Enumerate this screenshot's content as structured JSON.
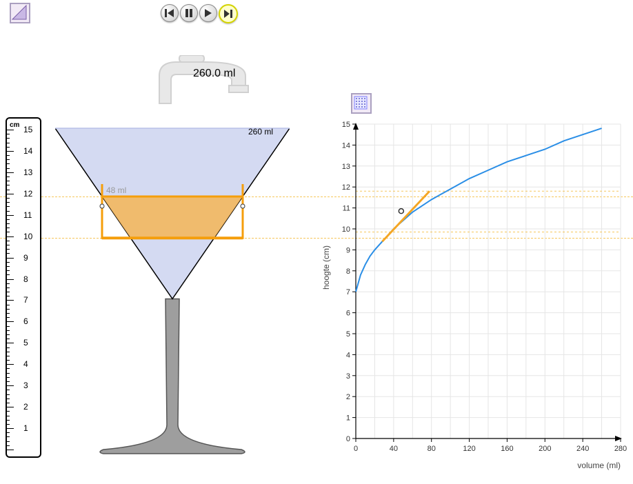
{
  "controls": {
    "restart": "⏮",
    "pause": "⏸",
    "play": "▶",
    "end": "⏭"
  },
  "tap": {
    "volume_label": "260.0 ml"
  },
  "ruler": {
    "unit": "cm",
    "max_tick": 15,
    "labels": [
      1,
      2,
      3,
      4,
      5,
      6,
      7,
      8,
      9,
      10,
      11,
      12,
      13,
      14,
      15
    ]
  },
  "glass": {
    "total_volume_label": "260 ml",
    "slice_volume_label": "48 ml"
  },
  "markers": {
    "lower_height_cm": 9.85,
    "upper_height_cm": 11.8,
    "point_height_cm": 10.85,
    "point_volume_ml": 48
  },
  "chart_data": {
    "type": "line",
    "title": "",
    "xlabel": "volume (ml)",
    "ylabel": "hoogte (cm)",
    "xlim": [
      0,
      280
    ],
    "ylim": [
      0,
      15
    ],
    "xticks": [
      0,
      40,
      80,
      120,
      160,
      200,
      240,
      280
    ],
    "yticks": [
      0,
      1,
      2,
      3,
      4,
      5,
      6,
      7,
      8,
      9,
      10,
      11,
      12,
      13,
      14,
      15
    ],
    "series": [
      {
        "name": "hoogte",
        "color": "#2a8ee6",
        "x": [
          0,
          5,
          10,
          15,
          20,
          30,
          40,
          50,
          60,
          80,
          100,
          120,
          140,
          160,
          180,
          200,
          220,
          240,
          260
        ],
        "y": [
          7.0,
          7.8,
          8.3,
          8.7,
          9.0,
          9.5,
          10.0,
          10.4,
          10.8,
          11.4,
          11.9,
          12.4,
          12.8,
          13.2,
          13.5,
          13.8,
          14.2,
          14.5,
          14.8
        ]
      }
    ],
    "tangent": {
      "color": "#f5a623",
      "x0": 28,
      "y0": 9.4,
      "x1": 78,
      "y1": 11.8
    },
    "hlines": [
      {
        "y": 9.85,
        "color": "#f5b932"
      },
      {
        "y": 11.8,
        "color": "#f5b932"
      }
    ],
    "point": {
      "x": 48,
      "y": 10.85
    }
  }
}
